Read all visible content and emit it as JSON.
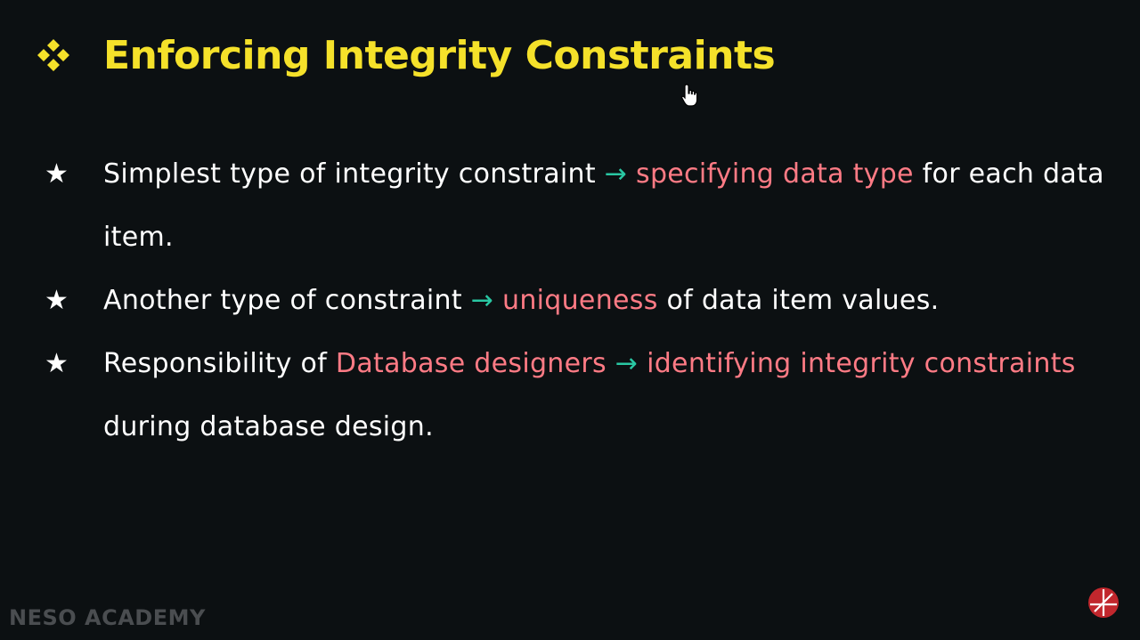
{
  "slide": {
    "title": "Enforcing Integrity Constraints",
    "title_bullet_icon": "four-diamond-icon",
    "bullet_icon": "star-icon",
    "bullets": [
      {
        "text_1": "Simplest type of integrity constraint",
        "arrow": "→",
        "highlight_1": "specifying data type",
        "text_2": "for each data item."
      },
      {
        "text_1": "Another type of constraint",
        "arrow": "→",
        "highlight_1": "uniqueness",
        "text_2": "of data item values."
      },
      {
        "text_1": "Responsibility of",
        "highlight_1": "Database designers",
        "arrow": "→",
        "highlight_2": "identifying integrity constraints",
        "text_2": "during database design."
      }
    ]
  },
  "watermark": "NESO ACADEMY",
  "colors": {
    "background": "#0c1012",
    "title": "#f5e12a",
    "highlight": "#ff7b85",
    "arrow": "#29c7a3",
    "text": "#ffffff"
  }
}
